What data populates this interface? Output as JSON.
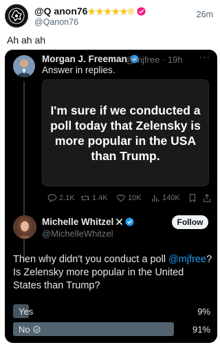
{
  "outer_post": {
    "author_name": "@Q anon76",
    "author_badges": "★★★★★®",
    "handle": "@Qanon76",
    "time": "26m",
    "text": "Ah ah ah"
  },
  "parent_tweet": {
    "name": "Morgan J. Freeman",
    "meta": "@mjfree · 19h",
    "text": "Answer in replies.",
    "image_text": "I'm sure if we conducted a poll today that Zelensky is more popular in the USA than Trump.",
    "more": "···",
    "stats": {
      "replies": "2.1K",
      "reposts": "1.4K",
      "likes": "10K",
      "views": "140K"
    }
  },
  "reply": {
    "name": "Michelle Whitzel",
    "handle": "@MichelleWhitzel",
    "follow_label": "Follow",
    "text_before": "Then why didn't you conduct a poll ",
    "mention": "@mjfree",
    "text_after": "? Is Zelensky more popular in the United States than Trump?",
    "poll": [
      {
        "label": "Yes",
        "percent_text": "9%",
        "percent": 9,
        "winner": false
      },
      {
        "label": "No",
        "percent_text": "91%",
        "percent": 91,
        "winner": true
      }
    ]
  },
  "colors": {
    "accent": "#1d9bf0",
    "gold": "#f5c518",
    "badge_pink": "#f91880",
    "poll_bar": "#536471"
  },
  "icons": [
    "profile-logo-icon",
    "verified-icon",
    "reply-icon",
    "repost-icon",
    "like-icon",
    "views-icon",
    "bookmark-icon",
    "share-icon",
    "x-logo-icon",
    "check-circle-icon"
  ]
}
